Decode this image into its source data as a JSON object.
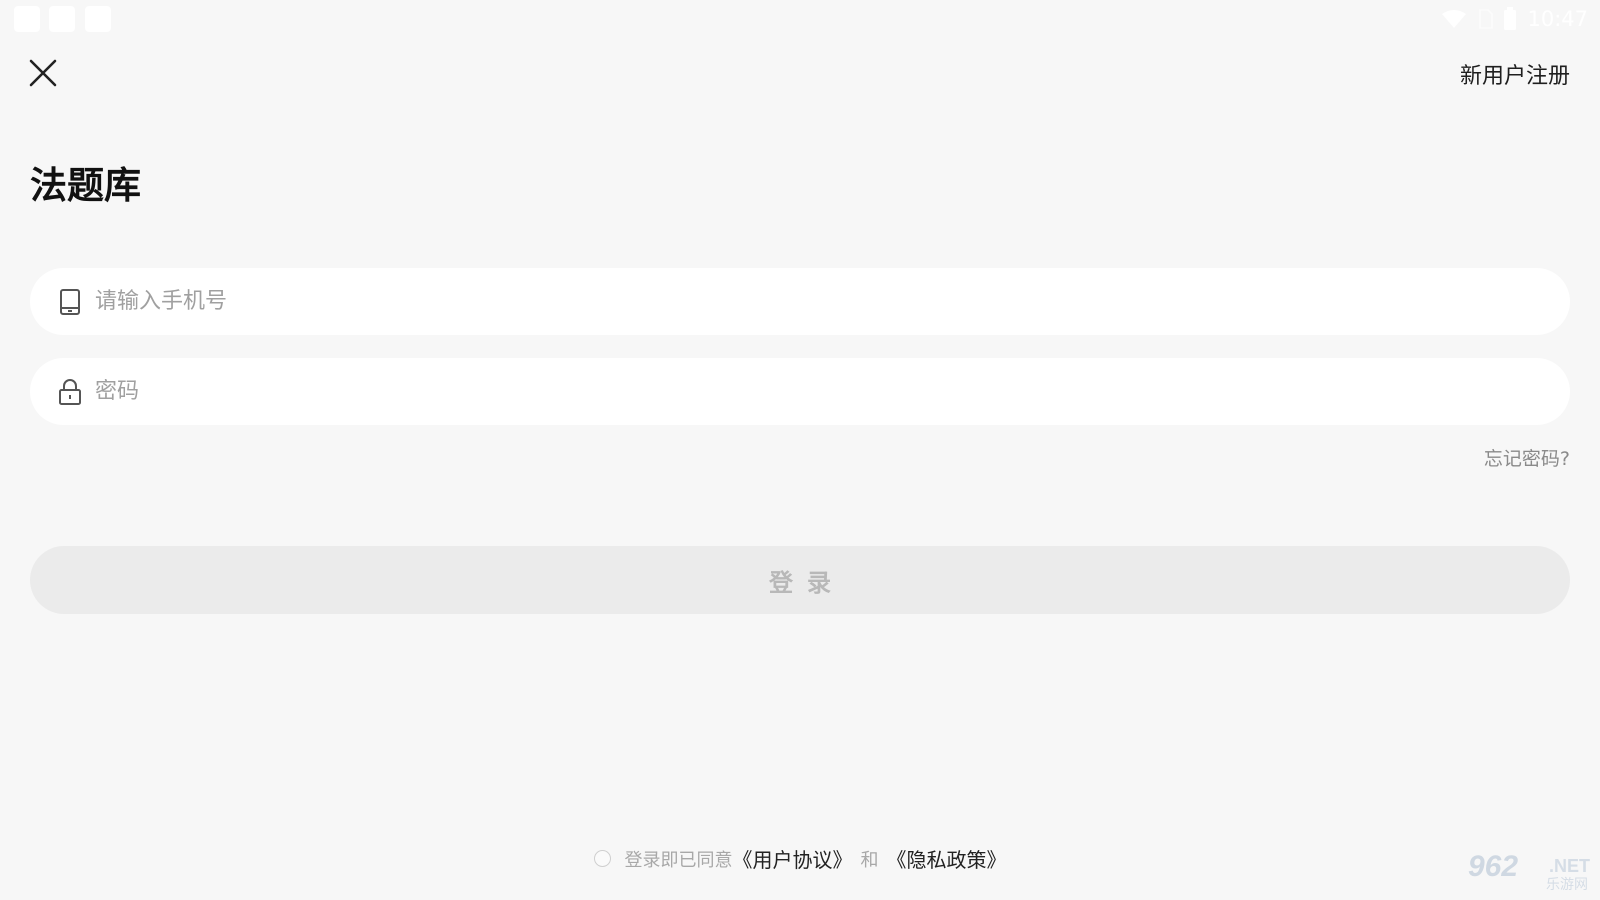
{
  "status_bar": {
    "time": "10:47",
    "icons": [
      "wifi-icon",
      "no-sim-icon",
      "battery-icon"
    ]
  },
  "header": {
    "close_icon": "close-icon",
    "register_label": "新用户注册"
  },
  "app_title": "法题库",
  "form": {
    "phone": {
      "value": "",
      "placeholder": "请输入手机号",
      "icon": "phone-icon"
    },
    "password": {
      "value": "",
      "placeholder": "密码",
      "icon": "lock-icon"
    },
    "forgot_label": "忘记密码?",
    "login_label": "登录"
  },
  "agreement": {
    "checked": false,
    "prefix": "登录即已同意",
    "user_agreement": "《用户协议》",
    "conjunction": "和",
    "privacy_policy": "《隐私政策》"
  },
  "watermark": {
    "number": "962",
    "suffix": ".NET",
    "caption": "乐游网"
  },
  "colors": {
    "background": "#f7f7f7",
    "field": "#ffffff",
    "login_button": "#ebebeb",
    "login_text": "#b8b8b8"
  }
}
